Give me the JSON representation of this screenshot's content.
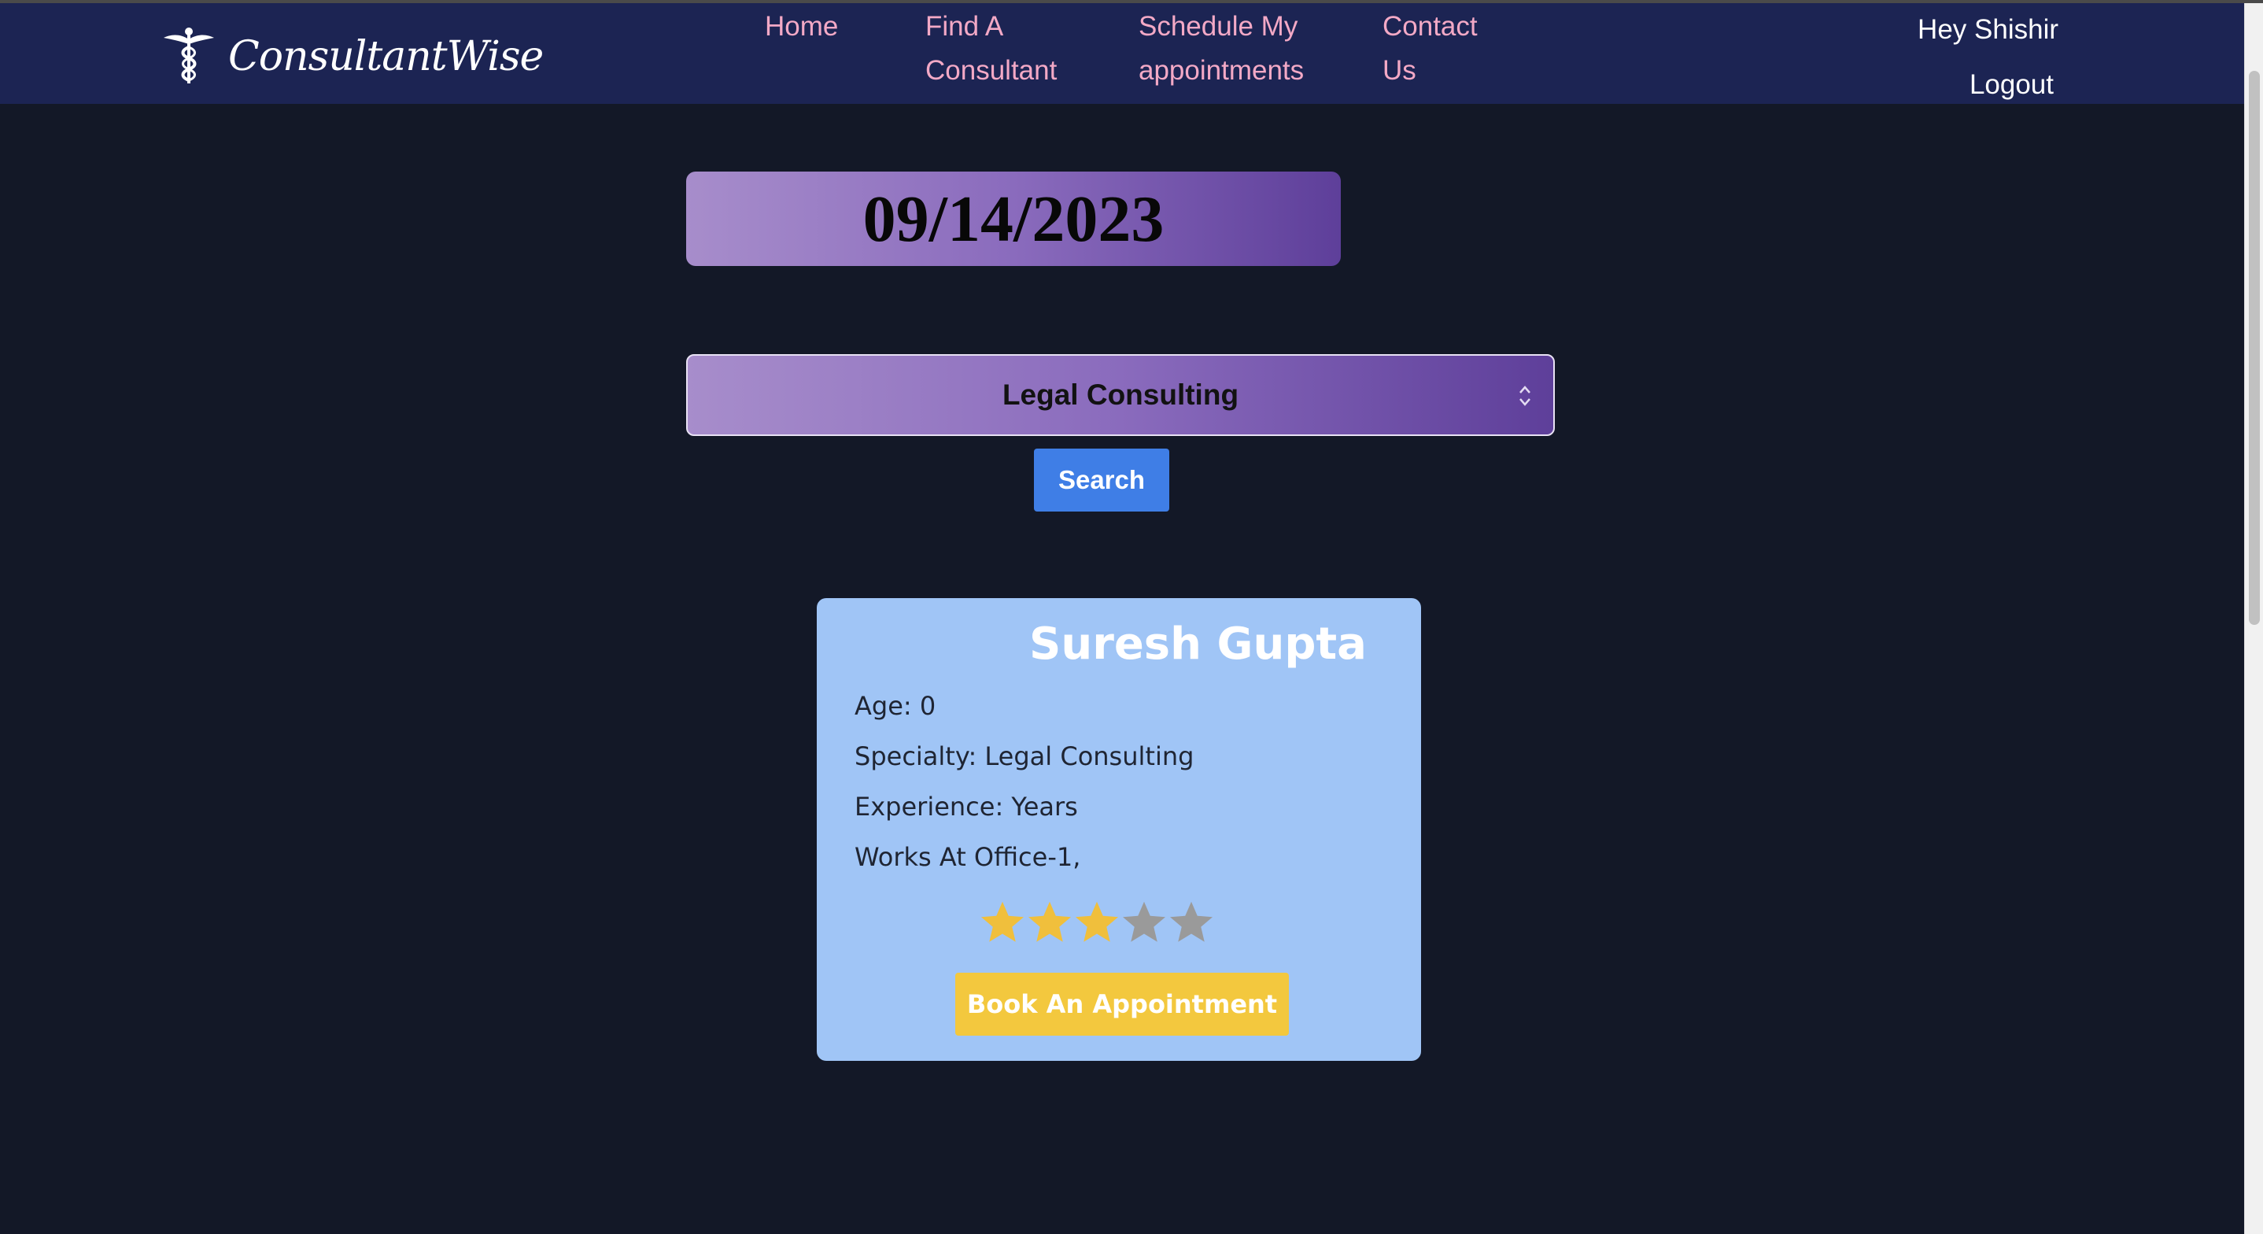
{
  "header": {
    "brand": "ConsultantWise",
    "brand_icon": "caduceus-icon",
    "nav": [
      {
        "line1": "Home",
        "line2": ""
      },
      {
        "line1": "Find A",
        "line2": "Consultant"
      },
      {
        "line1": "Schedule My",
        "line2": "appointments"
      },
      {
        "line1": "Contact",
        "line2": "Us"
      }
    ],
    "greeting": "Hey Shishir",
    "logout": "Logout"
  },
  "search": {
    "date": "09/14/2023",
    "category": "Legal Consulting",
    "button": "Search"
  },
  "results": [
    {
      "name": "Suresh Gupta",
      "age": "Age: 0",
      "specialty": "Specialty: Legal Consulting",
      "experience": "Experience: Years",
      "works_at": "Works At Office-1,",
      "rating": 3,
      "rating_max": 5,
      "book_button": "Book An Appointment"
    }
  ],
  "colors": {
    "background": "#131827",
    "navbar": "#1c2453",
    "nav_link": "#f3a9c6",
    "search_button": "#3f7ee6",
    "card": "#a0c5f6",
    "book_button": "#f3c83e",
    "star_filled": "#f0bf3c",
    "star_empty": "#9a9a9a"
  }
}
